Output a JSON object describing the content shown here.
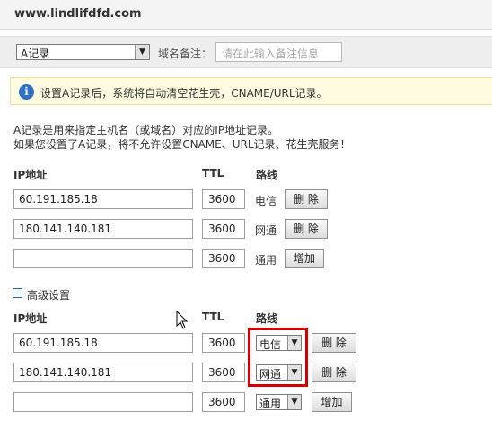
{
  "header": {
    "domain": "www.lindlifdfd.com"
  },
  "toolbar": {
    "record_type": "A记录",
    "remark_label": "域名备注：",
    "remark_placeholder": "请在此输入备注信息"
  },
  "notice": {
    "text": "设置A记录后，系统将自动清空花生壳，CNAME/URL记录。"
  },
  "description": [
    "A记录是用来指定主机名（或域名）对应的IP地址记录。",
    "如果您设置了A记录，将不允许设置CNAME、URL记录、花生壳服务！"
  ],
  "columns": {
    "ip": "IP地址",
    "ttl": "TTL",
    "route": "路线"
  },
  "basic_rows": [
    {
      "ip": "60.191.185.18",
      "ttl": "3600",
      "route": "电信",
      "action": "删 除"
    },
    {
      "ip": "180.141.140.181",
      "ttl": "3600",
      "route": "网通",
      "action": "删 除"
    },
    {
      "ip": "",
      "ttl": "3600",
      "route": "通用",
      "action": "增加"
    }
  ],
  "advanced": {
    "label": "高级设置",
    "rows": [
      {
        "ip": "60.191.185.18",
        "ttl": "3600",
        "route": "电信",
        "action": "删 除"
      },
      {
        "ip": "180.141.140.181",
        "ttl": "3600",
        "route": "网通",
        "action": "删 除"
      },
      {
        "ip": "",
        "ttl": "3600",
        "route": "通用",
        "action": "增加"
      }
    ]
  },
  "icons": {
    "info": "info-icon",
    "collapse": "collapse-icon",
    "dropdown": "chevron-down-icon",
    "cursor": "mouse-cursor-icon"
  },
  "colors": {
    "highlight": "#d40000",
    "notice_bg": "#fffbe0",
    "info_icon": "#2c6fc4"
  }
}
